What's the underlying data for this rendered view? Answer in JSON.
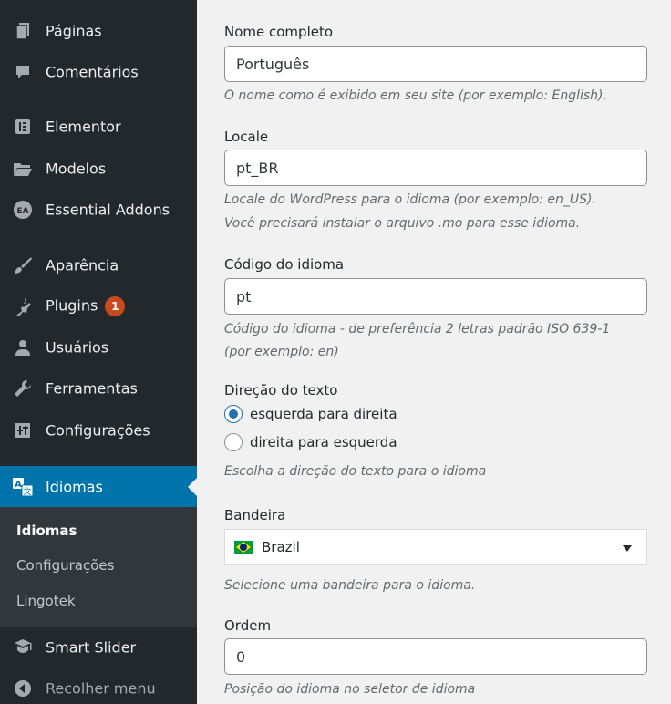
{
  "sidebar": {
    "items": [
      {
        "label": "Páginas",
        "icon": "pages-icon"
      },
      {
        "label": "Comentários",
        "icon": "comments-icon"
      },
      {
        "label": "Elementor",
        "icon": "elementor-icon"
      },
      {
        "label": "Modelos",
        "icon": "folder-icon"
      },
      {
        "label": "Essential Addons",
        "icon": "essential-addons-icon"
      },
      {
        "label": "Aparência",
        "icon": "brush-icon"
      },
      {
        "label": "Plugins",
        "icon": "plugin-icon",
        "badge": "1"
      },
      {
        "label": "Usuários",
        "icon": "users-icon"
      },
      {
        "label": "Ferramentas",
        "icon": "wrench-icon"
      },
      {
        "label": "Configurações",
        "icon": "settings-icon"
      },
      {
        "label": "Idiomas",
        "icon": "translate-icon"
      },
      {
        "label": "Smart Slider",
        "icon": "smart-slider-icon"
      },
      {
        "label": "Recolher menu",
        "icon": "collapse-icon"
      }
    ],
    "submenu": [
      "Idiomas",
      "Configurações",
      "Lingotek"
    ]
  },
  "form": {
    "full_name": {
      "label": "Nome completo",
      "value": "Português",
      "description": "O nome como é exibido em seu site (por exemplo: English)."
    },
    "locale": {
      "label": "Locale",
      "value": "pt_BR",
      "description_line1": "Locale do WordPress para o idioma (por exemplo: en_US).",
      "description_line2": "Você precisará instalar o arquivo .mo para esse idioma."
    },
    "language_code": {
      "label": "Código do idioma",
      "value": "pt",
      "description_line1": "Código do idioma - de preferência 2 letras padrão ISO 639-1",
      "description_line2": "(por exemplo: en)"
    },
    "text_direction": {
      "label": "Direção do texto",
      "option_ltr": "esquerda para direita",
      "option_rtl": "direita para esquerda",
      "selected": "ltr",
      "description": "Escolha a direção do texto para o idioma"
    },
    "flag": {
      "label": "Bandeira",
      "selected": "Brazil",
      "description": "Selecione uma bandeira para o idioma."
    },
    "order": {
      "label": "Ordem",
      "value": "0",
      "description": "Posição do idioma no seletor de idioma"
    }
  },
  "colors": {
    "sidebar_bg": "#23282d",
    "submenu_bg": "#32373c",
    "active_bg": "#0073aa",
    "badge_bg": "#ca4a1f",
    "radio_accent": "#2271b1"
  }
}
